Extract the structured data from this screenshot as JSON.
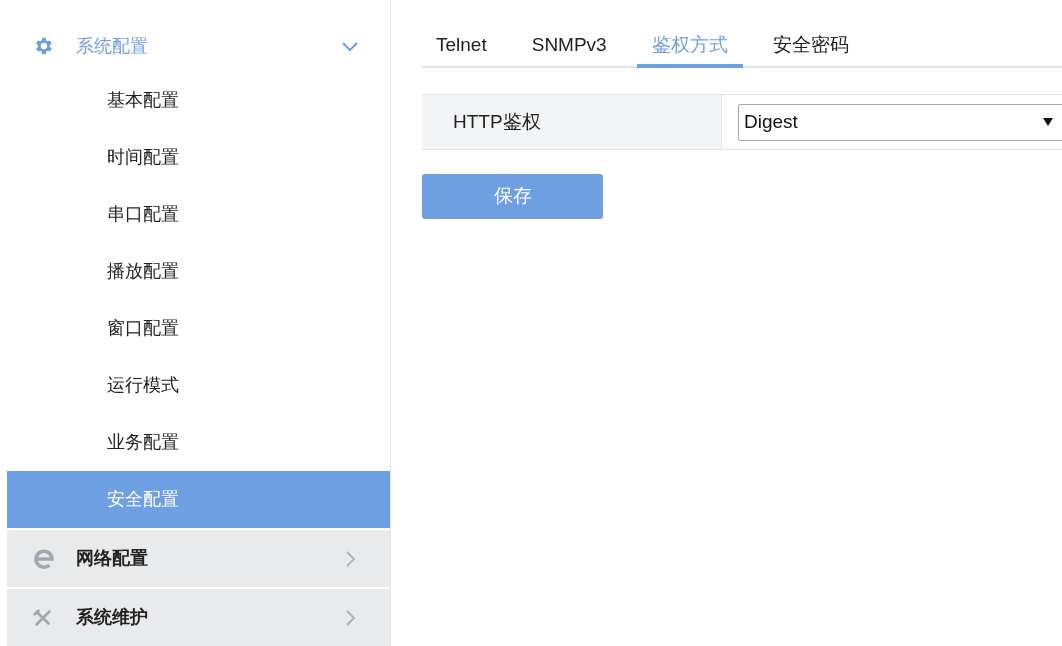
{
  "sidebar": {
    "groups": [
      {
        "label": "系统配置",
        "expanded": true,
        "children": [
          {
            "label": "基本配置",
            "selected": false
          },
          {
            "label": "时间配置",
            "selected": false
          },
          {
            "label": "串口配置",
            "selected": false
          },
          {
            "label": "播放配置",
            "selected": false
          },
          {
            "label": "窗口配置",
            "selected": false
          },
          {
            "label": "运行模式",
            "selected": false
          },
          {
            "label": "业务配置",
            "selected": false
          },
          {
            "label": "安全配置",
            "selected": true
          }
        ]
      },
      {
        "label": "网络配置",
        "expanded": false
      },
      {
        "label": "系统维护",
        "expanded": false
      }
    ]
  },
  "tabs": [
    {
      "label": "Telnet",
      "selected": false
    },
    {
      "label": "SNMPv3",
      "selected": false
    },
    {
      "label": "鉴权方式",
      "selected": true
    },
    {
      "label": "安全密码",
      "selected": false
    }
  ],
  "form": {
    "rows": [
      {
        "label": "HTTP鉴权",
        "value": "Digest"
      }
    ]
  },
  "buttons": [
    "保存"
  ]
}
